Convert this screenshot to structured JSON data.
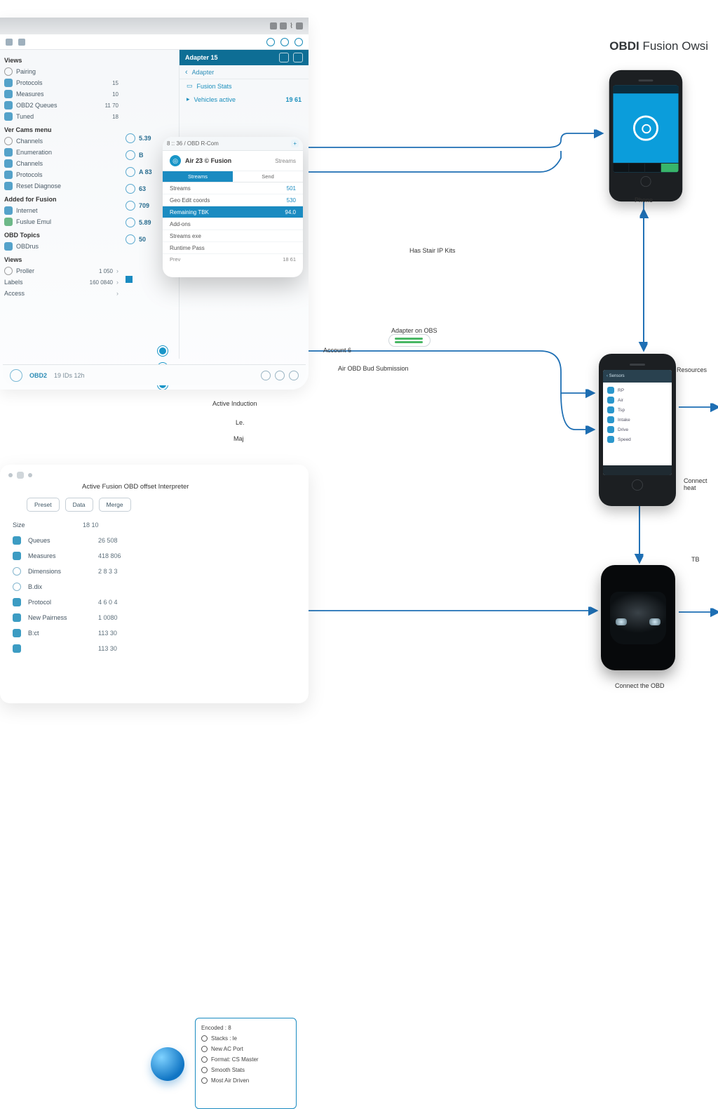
{
  "title": {
    "brand": "OBDI",
    "product": "Fusion",
    "suffix": "Owsi"
  },
  "tablet": {
    "bluebar": "Adapter 15",
    "sub": "Adapter",
    "panel_head": "Fusion Stats",
    "link_label": "Vehicles active",
    "link_amount": "19 61",
    "section1": "Views",
    "rows1": [
      {
        "l": "Pairing",
        "v": ""
      },
      {
        "l": "Protocols",
        "v": "15"
      },
      {
        "l": "Measures",
        "v": "10"
      },
      {
        "l": "OBD2 Queues",
        "v": "11 70"
      },
      {
        "l": "Tuned",
        "v": "18"
      }
    ],
    "section2": "Ver Cams menu",
    "rows2": [
      {
        "l": "Channels",
        "v": ""
      },
      {
        "l": "Enumeration",
        "v": ""
      },
      {
        "l": "Channels",
        "v": ""
      },
      {
        "l": "Protocols",
        "v": ""
      },
      {
        "l": "Reset Diagnose",
        "v": ""
      }
    ],
    "section3": "Added for Fusion",
    "rows3": [
      {
        "l": "Internet",
        "v": ""
      },
      {
        "l": "Fuslue Emul",
        "v": ""
      }
    ],
    "section4": "OBD Topics",
    "rows4": [
      {
        "l": "OBDrus",
        "v": ""
      }
    ],
    "section5": "Views",
    "rows5": [
      {
        "l": "Proller",
        "v": "1 050"
      },
      {
        "l": "Labels",
        "v": "160 0840"
      },
      {
        "l": "Access",
        "v": ""
      }
    ],
    "mid": [
      {
        "v": "5.39"
      },
      {
        "v": "B"
      },
      {
        "v": "A 83"
      },
      {
        "v": "63"
      },
      {
        "v": "709"
      },
      {
        "v": "5.89"
      },
      {
        "v": "50"
      }
    ],
    "modal": {
      "head": "8 :: 36 / OBD R-Com",
      "btn": "+",
      "title": "Air 23 © Fusion",
      "right": "Streams",
      "tabs": [
        "Streams",
        "Send"
      ],
      "items": [
        {
          "l": "Streams",
          "v": "501"
        },
        {
          "l": "Geo Edit coords",
          "v": "530"
        },
        {
          "l": "Remaining TBK",
          "v": "94.0"
        },
        {
          "l": "Add-ons",
          "v": ""
        },
        {
          "l": "Streams exe",
          "v": ""
        },
        {
          "l": "Runtime Pass",
          "v": ""
        }
      ],
      "foot": [
        "Prev",
        "18 61"
      ]
    },
    "dock": {
      "label": "OBD2",
      "sub": "19 IDs 12h"
    }
  },
  "card": {
    "title": "Active Fusion OBD offset Interpreter",
    "seg": [
      "Preset",
      "Data",
      "Merge"
    ],
    "rows": [
      {
        "k": "Size",
        "v": "18 10"
      },
      {
        "k": "Queues",
        "v": "26 508"
      },
      {
        "k": "Measures",
        "v": "418 806"
      },
      {
        "k": "Dimensions",
        "v": "2 8 3 3"
      },
      {
        "k": "B.dix",
        "v": ""
      },
      {
        "k": "Protocol",
        "v": "4 6 0 4"
      },
      {
        "k": "New Pairness",
        "v": "1 0080"
      },
      {
        "k": "B:ct",
        "v": "113 30"
      },
      {
        "k": "",
        "v": "113 30"
      }
    ],
    "pop": [
      "Encoded : 8",
      "Stacks : le",
      "New AC Port",
      "Format: CS Master",
      "Smooth Stats",
      "Most Air Driven"
    ]
  },
  "labels": {
    "phone": "Phone",
    "car": "Connect the OBD",
    "obs": "Adapter on OBS",
    "act": "Account 6",
    "obdl": "Air OBD Bud Submission",
    "note": "Has Stair IP Kits",
    "actb": "Active Induction",
    "le": "Le.",
    "maj": "Maj",
    "cb": "Connect heat",
    "tb": "TB",
    "rset": "Resources"
  },
  "phone2": {
    "title": "Sensors",
    "items": [
      "RP",
      "Air",
      "Tsp",
      "Intake",
      "Drive",
      "Speed"
    ]
  }
}
